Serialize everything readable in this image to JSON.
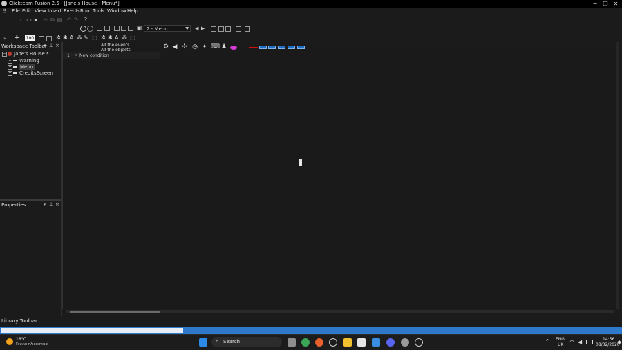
{
  "window": {
    "title": "Clickteam Fusion 2.5 - [Jane's House - Menu*]",
    "controls": {
      "minimize": "−",
      "restore": "❐",
      "close": "✕"
    }
  },
  "menubar": {
    "items": [
      "File",
      "Edit",
      "View",
      "Insert",
      "Events",
      "Run",
      "Tools",
      "Window",
      "Help"
    ]
  },
  "toolbar": {
    "frame_select_value": "2 - Menu",
    "zoom_value": "100"
  },
  "workspace": {
    "title": "Workspace Toolbar",
    "pin": "⊥",
    "close": "×",
    "tree": {
      "root": "Jane's House *",
      "frames": [
        "Warning",
        "Menu",
        "CreditsScreen"
      ],
      "selected": "Menu"
    }
  },
  "properties": {
    "title": "Properties",
    "pin": "⊥",
    "close": "×"
  },
  "library": {
    "title": "Library Toolbar"
  },
  "event_editor": {
    "header_all_events": "All the events",
    "header_all_objects": "All the objects",
    "rows": [
      {
        "number": "1",
        "condition": "New condition"
      }
    ]
  },
  "taskbar": {
    "weather_temp": "18°C",
    "weather_desc": "Γενικά ηλιοφάνεια",
    "search_label": "Search",
    "lang_top": "ENG",
    "lang_bottom": "UK",
    "time": "14:56",
    "date": "08/02/2026",
    "tray_chevron": "^"
  },
  "colors": {
    "accent_status": "#2e79c9",
    "background": "#1b1b1b",
    "ext_icon_blue": "#1f6fc4",
    "red_line": "#d01010"
  }
}
